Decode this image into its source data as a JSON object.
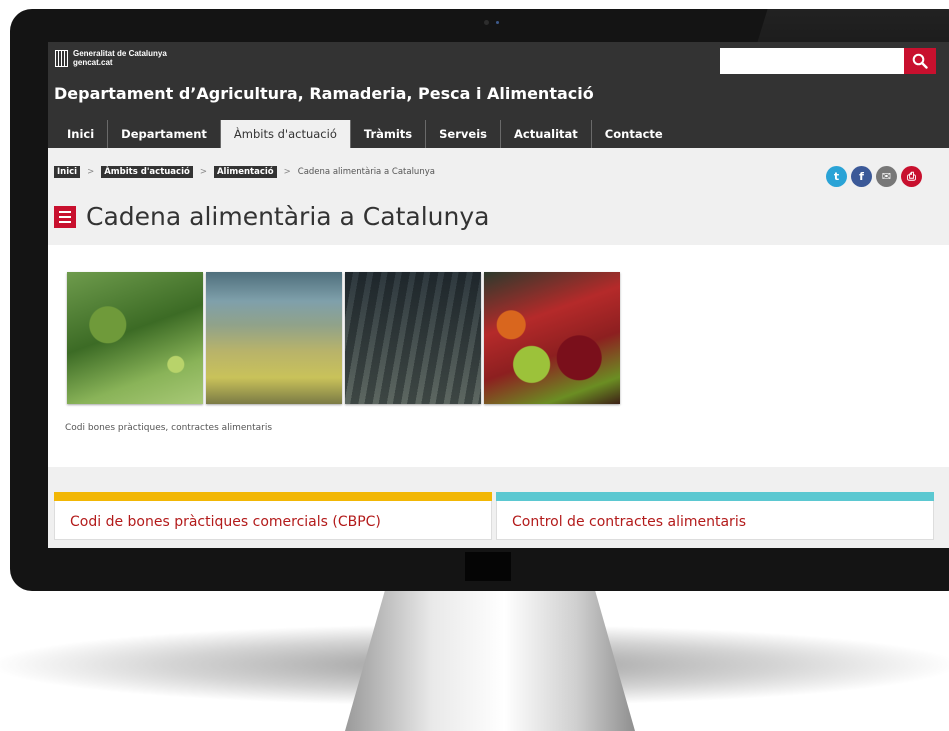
{
  "header": {
    "logo_line1": "Generalitat de Catalunya",
    "logo_line2": "gencat.cat",
    "search_placeholder": "",
    "department_title": "Departament d’Agricultura, Ramaderia, Pesca i Alimentació"
  },
  "nav": {
    "items": [
      {
        "label": "Inici"
      },
      {
        "label": "Departament"
      },
      {
        "label": "Àmbits d'actuació"
      },
      {
        "label": "Tràmits"
      },
      {
        "label": "Serveis"
      },
      {
        "label": "Actualitat"
      },
      {
        "label": "Contacte"
      }
    ],
    "active": "Àmbits d'actuació"
  },
  "breadcrumb": {
    "items": [
      "Inici",
      "Àmbits d'actuació",
      "Alimentació"
    ],
    "current": "Cadena alimentària a Catalunya",
    "separator": ">"
  },
  "social": {
    "twitter_glyph": "t",
    "facebook_glyph": "f",
    "email_glyph": "✉",
    "print_glyph": "⎙"
  },
  "page": {
    "title": "Cadena alimentària a Catalunya",
    "photo_caption": "Codi bones pràctiques, contractes alimentaris"
  },
  "cards": [
    {
      "label": "Codi de bones pràctiques comercials (CBPC)",
      "accent": "#f2b705"
    },
    {
      "label": "Control de contractes alimentaris",
      "accent": "#5bc8d1"
    }
  ],
  "colors": {
    "brand_red": "#c8102e",
    "header_bg": "#333333",
    "twitter": "#2aa3d6",
    "facebook": "#3b5998",
    "email": "#777777",
    "print": "#c8102e"
  },
  "icons": [
    "search-icon",
    "menu-icon",
    "twitter-icon",
    "facebook-icon",
    "email-icon",
    "print-icon",
    "generalitat-logo-icon"
  ]
}
